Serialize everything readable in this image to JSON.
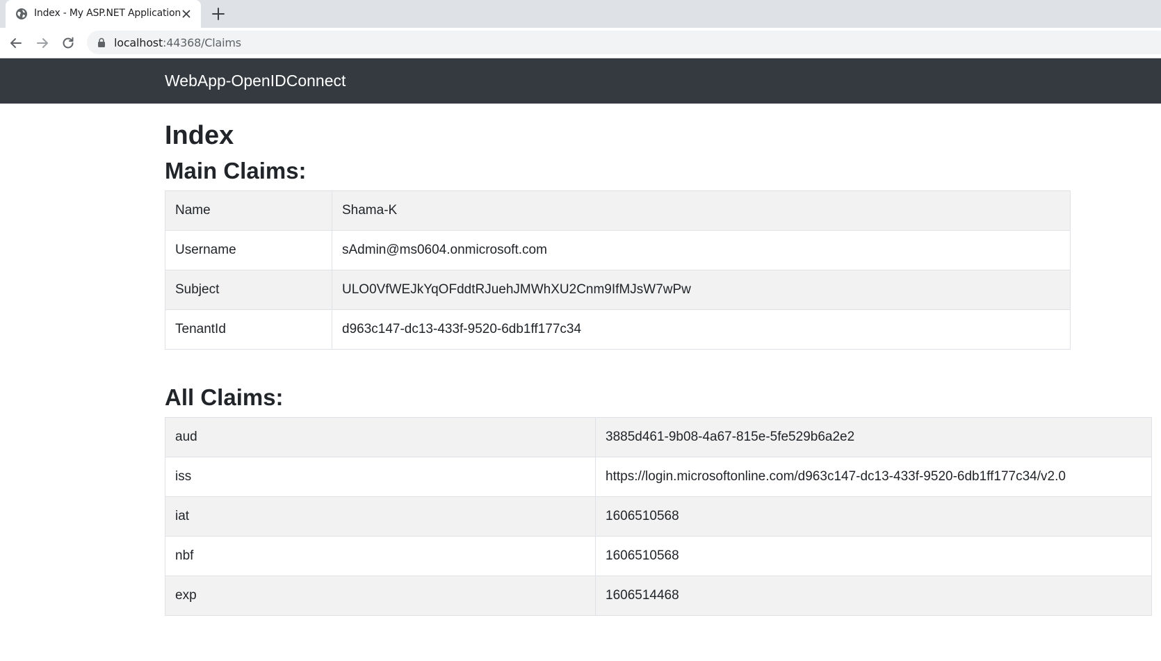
{
  "browser": {
    "tab_title": "Index - My ASP.NET Application",
    "url_host": "localhost",
    "url_rest": ":44368/Claims"
  },
  "navbar": {
    "brand": "WebApp-OpenIDConnect"
  },
  "page": {
    "title": "Index",
    "main_claims_heading": "Main Claims:",
    "all_claims_heading": "All Claims:"
  },
  "main_claims": [
    {
      "key": "Name",
      "value": "Shama-K"
    },
    {
      "key": "Username",
      "value": "sAdmin@ms0604.onmicrosoft.com"
    },
    {
      "key": "Subject",
      "value": "ULO0VfWEJkYqOFddtRJuehJMWhXU2Cnm9IfMJsW7wPw"
    },
    {
      "key": "TenantId",
      "value": "d963c147-dc13-433f-9520-6db1ff177c34"
    }
  ],
  "all_claims": [
    {
      "key": "aud",
      "value": "3885d461-9b08-4a67-815e-5fe529b6a2e2"
    },
    {
      "key": "iss",
      "value": "https://login.microsoftonline.com/d963c147-dc13-433f-9520-6db1ff177c34/v2.0"
    },
    {
      "key": "iat",
      "value": "1606510568"
    },
    {
      "key": "nbf",
      "value": "1606510568"
    },
    {
      "key": "exp",
      "value": "1606514468"
    }
  ],
  "colors": {
    "navbar_bg": "#343a40",
    "stripe_bg": "#f2f2f2",
    "tabstrip_bg": "#dee1e6"
  },
  "icons": [
    "globe-icon",
    "close-icon",
    "plus-icon",
    "back-arrow-icon",
    "forward-arrow-icon",
    "reload-icon",
    "lock-icon"
  ]
}
